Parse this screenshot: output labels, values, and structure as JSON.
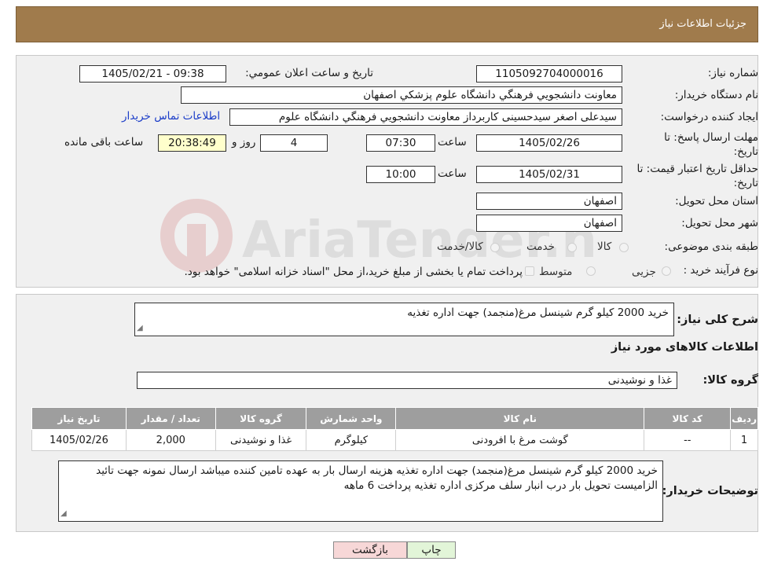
{
  "header": {
    "title": "جزئیات اطلاعات نیاز"
  },
  "info": {
    "need_number_label": "شماره نیاز:",
    "need_number": "1105092704000016",
    "announce_label": "تاريخ و ساعت اعلان عمومي:",
    "announce_value": "1405/02/21 - 09:38",
    "buyer_org_label": "نام دستگاه خریدار:",
    "buyer_org": "معاونت دانشجويي فرهنگي دانشگاه علوم پزشكي اصفهان",
    "creator_label": "ایجاد کننده درخواست:",
    "creator": "سیدعلی اصغر سیدحسینی کاربرداز معاونت دانشجويي فرهنگي دانشگاه علوم",
    "contact_link": "اطلاعات تماس خریدار",
    "deadline_label_1": "مهلت ارسال پاسخ: تا",
    "deadline_label_2": "تاریخ:",
    "deadline_date": "1405/02/26",
    "time_label": "ساعت",
    "deadline_time": "07:30",
    "days_value": "4",
    "days_label": "روز و",
    "remaining_time": "20:38:49",
    "remaining_label": "ساعت باقی مانده",
    "validity_label_1": "حداقل تاریخ اعتبار قیمت: تا",
    "validity_label_2": "تاریخ:",
    "validity_date": "1405/02/31",
    "validity_time_label": "ساعت",
    "validity_time": "10:00",
    "province_label": "استان محل تحویل:",
    "province": "اصفهان",
    "city_label": "شهر محل تحویل:",
    "city": "اصفهان",
    "category_label": "طبقه بندی موضوعی:",
    "category_options": [
      "کالا",
      "خدمت",
      "کالا/خدمت"
    ],
    "process_label": "نوع فرآیند خرید :",
    "process_options": [
      "جزیی",
      "متوسط"
    ],
    "process_note": "پرداخت تمام یا بخشی از مبلغ خرید،از محل \"اسناد خزانه اسلامی\" خواهد بود."
  },
  "need": {
    "summary_label": "شرح کلی نیاز:",
    "summary": "خرید 2000 کیلو گرم شینسل مرغ(منجمد) جهت اداره تغذیه",
    "goods_info_title": "اطلاعات کالاهای مورد نیاز",
    "goods_group_label": "گروه کالا:",
    "goods_group": "غذا و نوشیدنی"
  },
  "table": {
    "headers": [
      "ردیف",
      "کد کالا",
      "نام کالا",
      "واحد شمارش",
      "گروه کالا",
      "تعداد / مقدار",
      "تاریخ نیاز"
    ],
    "rows": [
      [
        "1",
        "--",
        "گوشت مرغ با افرودنی",
        "کیلوگرم",
        "غذا و نوشیدنی",
        "2,000",
        "1405/02/26"
      ]
    ]
  },
  "buyer_notes": {
    "label": "توضیحات خریدار:",
    "text": "خرید 2000 کیلو گرم شینسل مرغ(منجمد) جهت اداره تغذیه هزینه ارسال بار به عهده تامین کننده میباشد ارسال نمونه جهت تائید الزامیست تحویل بار درب انبار سلف مرکزی اداره تغذیه پرداخت 6 ماهه"
  },
  "buttons": {
    "print": "چاپ",
    "back": "بازگشت"
  },
  "colors": {
    "header": "#a07b4c",
    "back_button": "#f7d7d7",
    "print_button": "#e2f5d8",
    "link": "#1a3cc8"
  },
  "watermark_text": "AriaTender.neT"
}
